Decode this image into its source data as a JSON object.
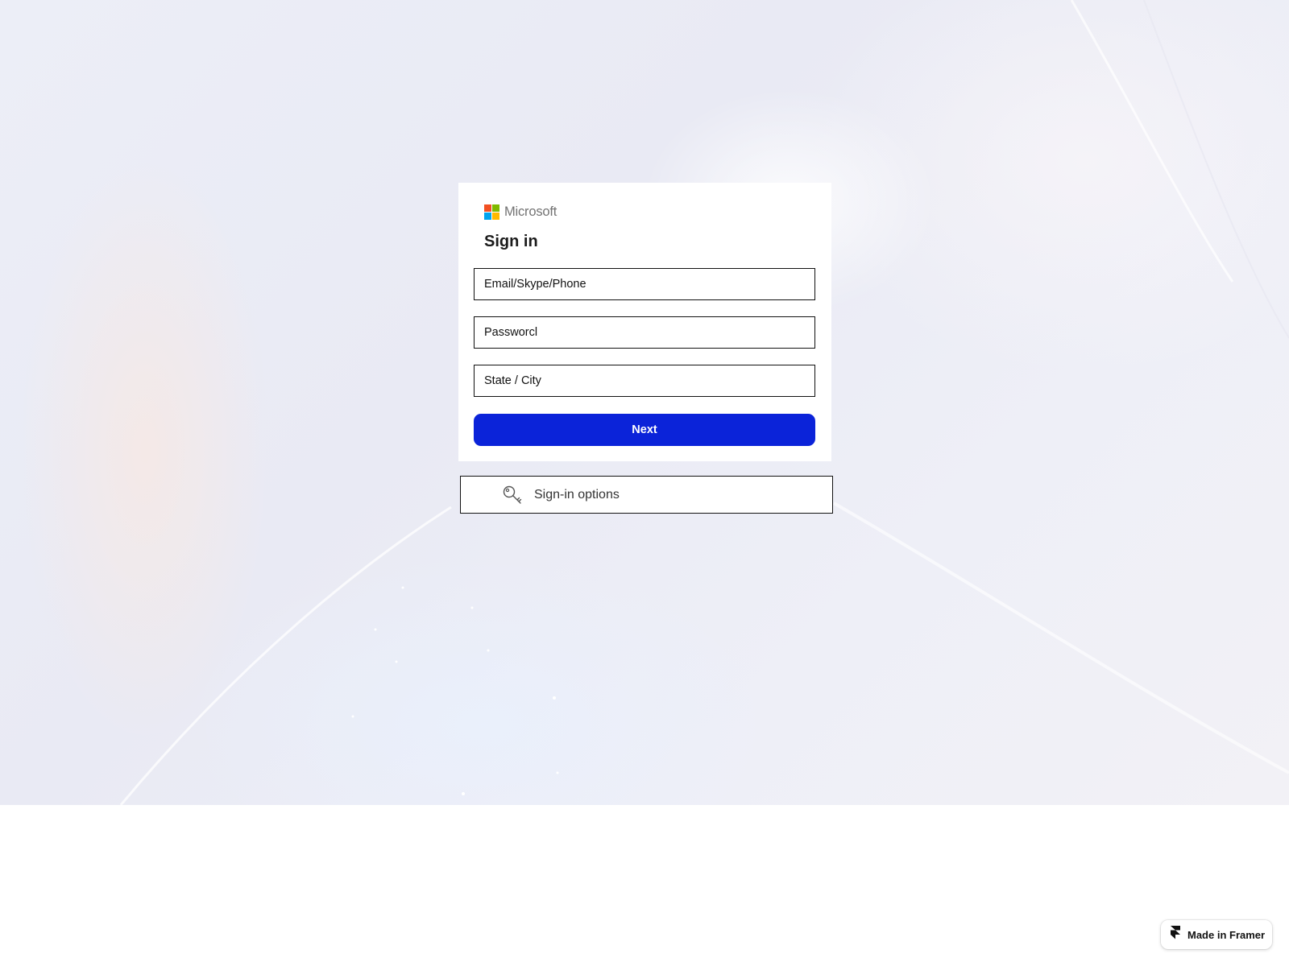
{
  "brand": {
    "name": "Microsoft",
    "logo_colors": [
      "#f25022",
      "#7fba00",
      "#00a4ef",
      "#ffb900"
    ]
  },
  "signin": {
    "title": "Sign in",
    "fields": [
      {
        "value": "Email/Skype/Phone"
      },
      {
        "value": "Passworcl"
      },
      {
        "value": "State / City"
      }
    ],
    "next_label": "Next",
    "next_color": "#0b23d9"
  },
  "signin_options": {
    "label": "Sign-in options",
    "icon": "key-icon"
  },
  "badge": {
    "label": "Made in Framer",
    "icon": "framer-logo-icon"
  }
}
